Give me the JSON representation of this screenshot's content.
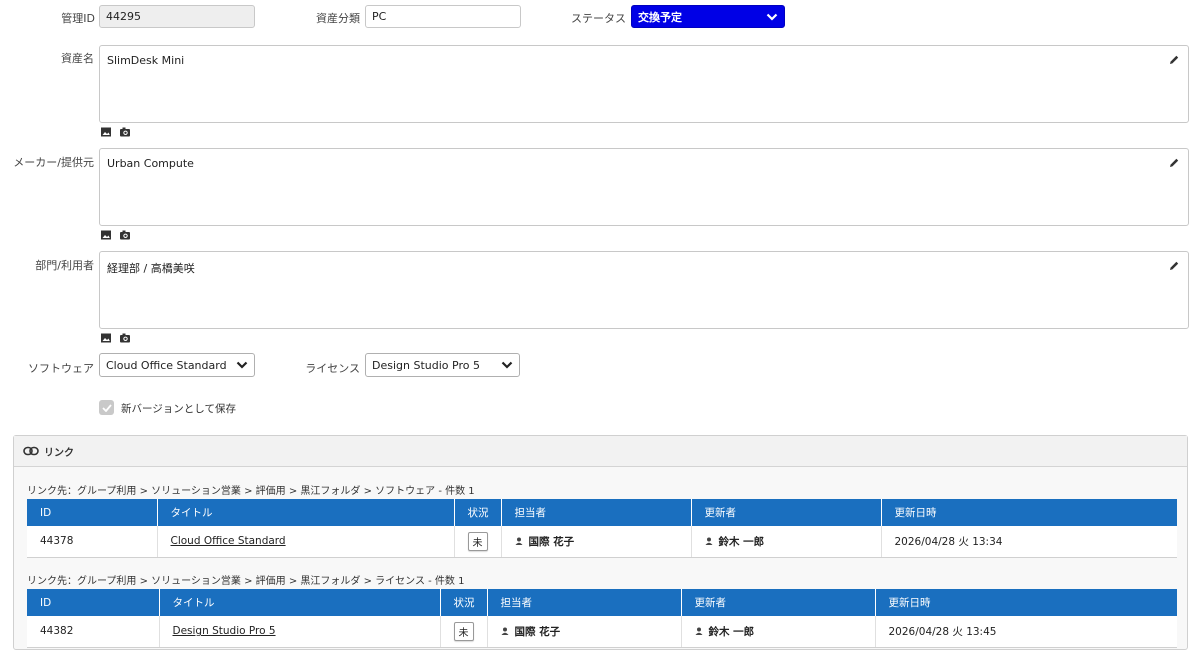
{
  "form": {
    "mgmt_id": {
      "label": "管理ID",
      "value": "44295"
    },
    "asset_class": {
      "label": "資産分類",
      "value": "PC"
    },
    "status": {
      "label": "ステータス",
      "value": "交換予定",
      "color": "#0000e6"
    },
    "asset_name": {
      "label": "資産名",
      "value": "SlimDesk Mini"
    },
    "maker": {
      "label": "メーカー/提供元",
      "value": "Urban Compute"
    },
    "dept_user": {
      "label": "部門/利用者",
      "value": "経理部 / 高橋美咲"
    },
    "software": {
      "label": "ソフトウェア",
      "value": "Cloud Office Standard"
    },
    "license": {
      "label": "ライセンス",
      "value": "Design Studio Pro 5"
    },
    "save_new_version": {
      "label": "新バージョンとして保存",
      "checked": true
    }
  },
  "links": {
    "title": "リンク",
    "sections": [
      {
        "breadcrumb": "リンク先：グループ利用 > ソリューション営業 > 評価用 > 黒江フォルダ > ソフトウェア - 件数 1",
        "headers": [
          "ID",
          "タイトル",
          "状況",
          "担当者",
          "更新者",
          "更新日時"
        ],
        "rows": [
          {
            "id": "44378",
            "title": "Cloud Office Standard",
            "state": "未",
            "assignee": "国際 花子",
            "updater": "鈴木 一郎",
            "updated": "2026/04/28 火 13:34"
          }
        ]
      },
      {
        "breadcrumb": "リンク先：グループ利用 > ソリューション営業 > 評価用 > 黒江フォルダ > ライセンス - 件数 1",
        "headers": [
          "ID",
          "タイトル",
          "状況",
          "担当者",
          "更新者",
          "更新日時"
        ],
        "rows": [
          {
            "id": "44382",
            "title": "Design Studio Pro 5",
            "state": "未",
            "assignee": "国際 花子",
            "updater": "鈴木 一郎",
            "updated": "2026/04/28 火 13:45"
          }
        ]
      }
    ]
  },
  "colors": {
    "table_header": "#1a6fbf",
    "status_select": "#0000e6"
  }
}
